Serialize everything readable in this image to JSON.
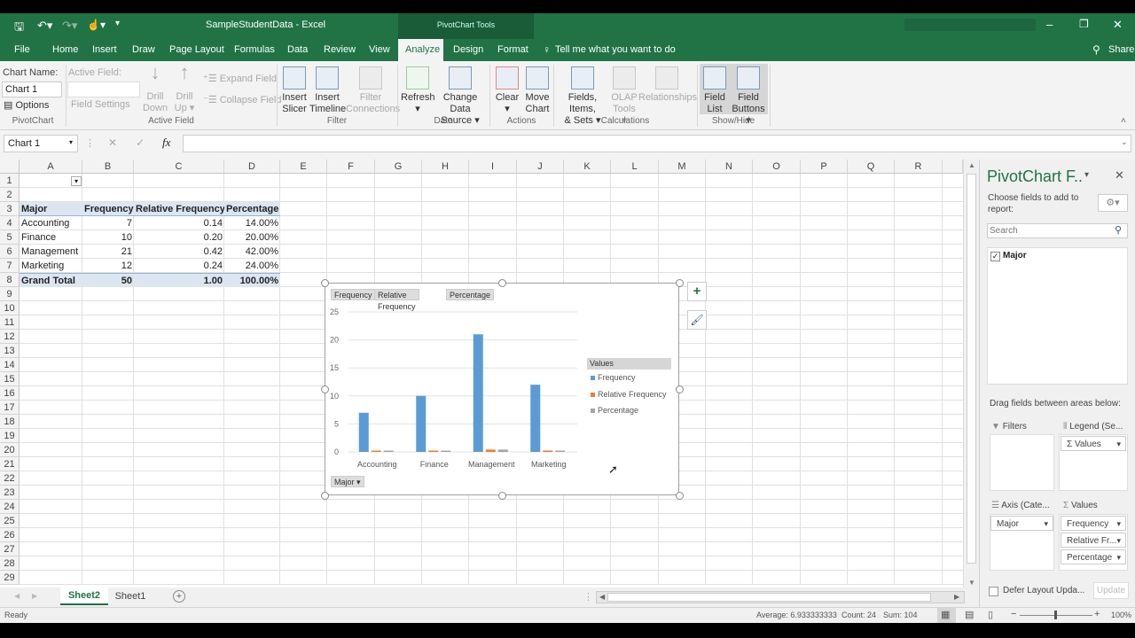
{
  "app": {
    "title": "SampleStudentData  -  Excel",
    "context_tab_group": "PivotChart Tools",
    "share": "Share",
    "tell_me": "Tell me what you want to do"
  },
  "colors": {
    "brand": "#217346",
    "series_frequency": "#5b9bd5",
    "series_relfreq": "#ed7d31",
    "series_pct": "#a5a5a5"
  },
  "tabs": [
    "File",
    "Home",
    "Insert",
    "Draw",
    "Page Layout",
    "Formulas",
    "Data",
    "Review",
    "View",
    "Analyze",
    "Design",
    "Format"
  ],
  "active_tab": "Analyze",
  "ribbon": {
    "chart_name_label": "Chart Name:",
    "chart_name_value": "Chart 1",
    "options": "Options",
    "group_pivotchart": "PivotChart",
    "active_field_label": "Active Field:",
    "field_settings": "Field Settings",
    "drill_down": [
      "Drill",
      "Down"
    ],
    "drill_up": [
      "Drill",
      "Up ▾"
    ],
    "expand_field": "Expand Field",
    "collapse_field": "Collapse Field",
    "group_active_field": "Active Field",
    "insert_slicer": [
      "Insert",
      "Slicer"
    ],
    "insert_timeline": [
      "Insert",
      "Timeline"
    ],
    "filter_connections": [
      "Filter",
      "Connections"
    ],
    "group_filter": "Filter",
    "refresh": [
      "Refresh",
      "▾"
    ],
    "change_data_source": [
      "Change Data",
      "Source ▾"
    ],
    "group_data": "Data",
    "clear": [
      "Clear",
      "▾"
    ],
    "move_chart": [
      "Move",
      "Chart"
    ],
    "group_actions": "Actions",
    "fields_items_sets": [
      "Fields, Items,",
      "& Sets ▾"
    ],
    "olap_tools": [
      "OLAP",
      "Tools ▾"
    ],
    "relationships": [
      "Relationships",
      ""
    ],
    "group_calculations": "Calculations",
    "field_list": [
      "Field",
      "List"
    ],
    "field_buttons": [
      "Field",
      "Buttons ▾"
    ],
    "group_showhide": "Show/Hide"
  },
  "formula_bar": {
    "name_box": "Chart 1",
    "formula": ""
  },
  "sheet": {
    "columns": [
      "A",
      "B",
      "C",
      "D",
      "E",
      "F",
      "G",
      "H",
      "I",
      "J",
      "K",
      "L",
      "M",
      "N",
      "O",
      "P",
      "Q",
      "R"
    ],
    "row_numbers": [
      "1",
      "2",
      "3",
      "4",
      "5",
      "6",
      "7",
      "8",
      "9",
      "10",
      "11",
      "12",
      "13",
      "14",
      "15",
      "16",
      "17",
      "18",
      "19",
      "20",
      "21",
      "22",
      "23",
      "24",
      "25",
      "26",
      "27",
      "28",
      "29"
    ],
    "pivot": {
      "headers": [
        "Major",
        "Frequency",
        "Relative Frequency",
        "Percentage"
      ],
      "rows": [
        [
          "Accounting",
          "7",
          "0.14",
          "14.00%"
        ],
        [
          "Finance",
          "10",
          "0.20",
          "20.00%"
        ],
        [
          "Management",
          "21",
          "0.42",
          "42.00%"
        ],
        [
          "Marketing",
          "12",
          "0.24",
          "24.00%"
        ]
      ],
      "total": [
        "Grand Total",
        "50",
        "1.00",
        "100.00%"
      ]
    },
    "tabs": [
      "Sheet2",
      "Sheet1"
    ],
    "active_sheet": "Sheet2"
  },
  "chart_data": {
    "type": "bar",
    "categories": [
      "Accounting",
      "Finance",
      "Management",
      "Marketing"
    ],
    "series": [
      {
        "name": "Frequency",
        "values": [
          7,
          10,
          21,
          12
        ]
      },
      {
        "name": "Relative Frequency",
        "values": [
          0.14,
          0.2,
          0.42,
          0.24
        ]
      },
      {
        "name": "Percentage",
        "values": [
          0.14,
          0.2,
          0.42,
          0.24
        ]
      }
    ],
    "yticks": [
      "0",
      "5",
      "10",
      "15",
      "20",
      "25"
    ],
    "ylim": [
      0,
      25
    ],
    "grid": true,
    "legend_title": "Values",
    "legend_position": "right",
    "field_buttons": [
      "Frequency",
      "Relative Frequency",
      "Percentage"
    ],
    "axis_field_button": "Major"
  },
  "pane": {
    "title": "PivotChart F..",
    "choose": "Choose fields to add to report:",
    "search_placeholder": "Search",
    "fields": [
      {
        "name": "Major",
        "checked": true
      }
    ],
    "drag_label": "Drag fields between areas below:",
    "filters": "Filters",
    "legend": "Legend (Se...",
    "legend_items": [
      "Σ Values"
    ],
    "axis": "Axis (Cate...",
    "axis_items": [
      "Major"
    ],
    "values": "Values",
    "values_items": [
      "Frequency",
      "Relative Fr...",
      "Percentage"
    ],
    "defer": "Defer Layout Upda...",
    "update": "Update"
  },
  "status": {
    "ready": "Ready",
    "average": "Average: 6.933333333",
    "count": "Count: 24",
    "sum": "Sum: 104",
    "zoom": "100%",
    "zoom_level_percent": 100
  }
}
